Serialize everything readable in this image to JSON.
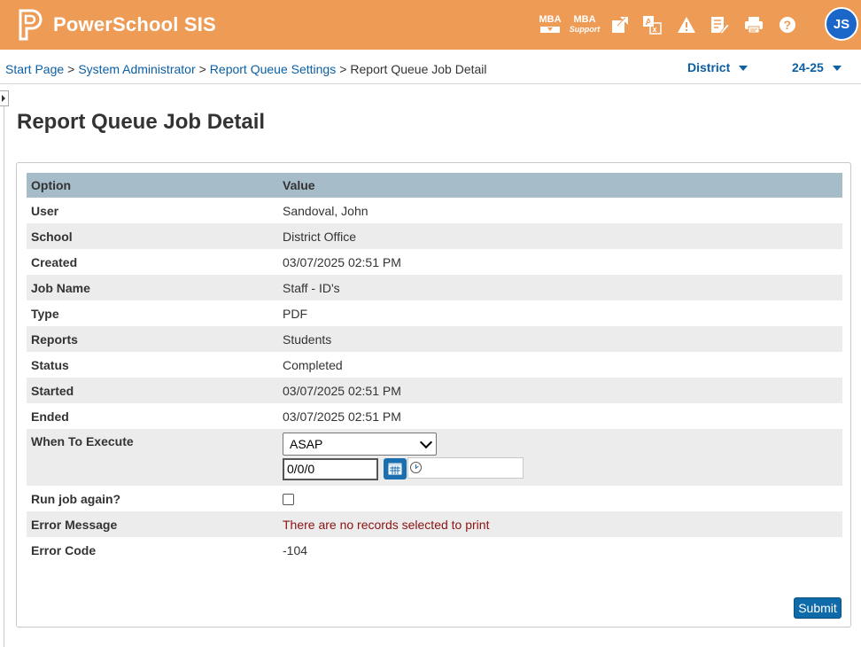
{
  "header": {
    "app_name": "PowerSchool SIS",
    "user_initials": "JS",
    "icons": [
      "mba-download-icon",
      "mba-support-icon",
      "external-link-icon",
      "translate-icon",
      "warning-icon",
      "notes-icon",
      "print-icon",
      "help-icon"
    ],
    "mba_label": "MBA",
    "mba_support_label": "MBA",
    "mba_support_sub": "Support",
    "accent_color": "#ee9b56"
  },
  "breadcrumb": {
    "items": [
      "Start Page",
      "System Administrator",
      "Report Queue Settings"
    ],
    "current": "Report Queue Job Detail",
    "separator": ">"
  },
  "selectors": {
    "district": "District",
    "term": "24-25"
  },
  "page": {
    "title": "Report Queue Job Detail"
  },
  "table": {
    "headers": [
      "Option",
      "Value"
    ],
    "rows": [
      {
        "label": "User",
        "value": "Sandoval, John"
      },
      {
        "label": "School",
        "value": "District Office"
      },
      {
        "label": "Created",
        "value": "03/07/2025 02:51 PM"
      },
      {
        "label": "Job Name",
        "value": "Staff - ID's"
      },
      {
        "label": "Type",
        "value": "PDF"
      },
      {
        "label": "Reports",
        "value": "Students"
      },
      {
        "label": "Status",
        "value": "Completed"
      },
      {
        "label": "Started",
        "value": "03/07/2025 02:51 PM"
      },
      {
        "label": "Ended",
        "value": "03/07/2025 02:51 PM"
      }
    ],
    "when_to_execute": {
      "label": "When To Execute",
      "selected": "ASAP",
      "date_value": "0/0/0",
      "time_value": ""
    },
    "run_again": {
      "label": "Run job again?",
      "checked": false
    },
    "error_message": {
      "label": "Error Message",
      "value": "There are no records selected to print"
    },
    "error_code": {
      "label": "Error Code",
      "value": "-104"
    }
  },
  "actions": {
    "submit_label": "Submit"
  }
}
